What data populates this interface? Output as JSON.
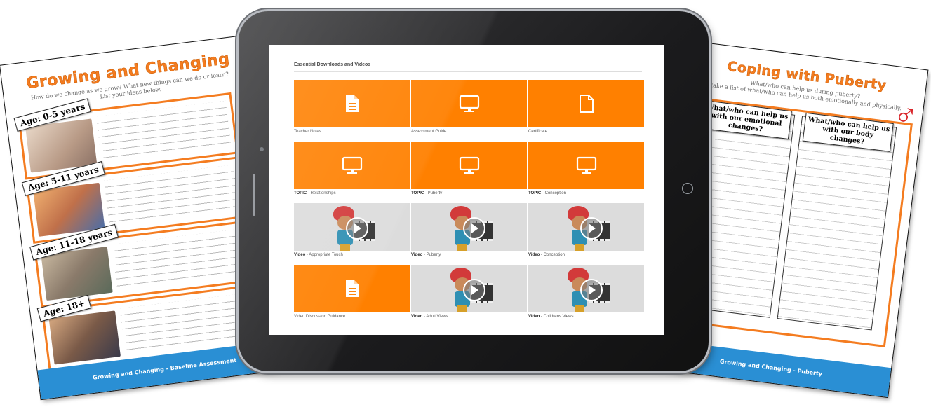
{
  "left_sheet": {
    "title": "Growing and Changing",
    "subtitle_line1": "How do we change as we grow? What new things can we do or learn?",
    "subtitle_line2": "List your ideas below.",
    "ages": [
      "Age: 0-5 years",
      "Age: 5-11 years",
      "Age: 11-18 years",
      "Age: 18+"
    ],
    "footer": "Growing and Changing - Baseline Assessment"
  },
  "right_sheet": {
    "title": "Coping with Puberty",
    "subtitle_line1": "What/who can help us during puberty?",
    "subtitle_line2": "Make a list of what/who can help us both emotionally and physically.",
    "col1_header": "What/who can help us with our emotional changes?",
    "col2_header": "What/who can help us with our body changes?",
    "footer": "Growing and Changing - Puberty",
    "female_symbol": "♀",
    "male_symbol": "♂"
  },
  "screen": {
    "title": "Essential Downloads and Videos",
    "tiles": [
      {
        "kind": "orange",
        "icon": "document-icon",
        "prefix": "",
        "label": "Teacher Notes"
      },
      {
        "kind": "orange",
        "icon": "monitor-icon",
        "prefix": "",
        "label": "Assessment Guide"
      },
      {
        "kind": "orange",
        "icon": "blank-page-icon",
        "prefix": "",
        "label": "Certificate"
      },
      {
        "kind": "orange",
        "icon": "monitor-icon",
        "prefix": "TOPIC",
        "label": " - Relationships"
      },
      {
        "kind": "orange",
        "icon": "monitor-icon",
        "prefix": "TOPIC",
        "label": " - Puberty"
      },
      {
        "kind": "orange",
        "icon": "monitor-icon",
        "prefix": "TOPIC",
        "label": " - Conception"
      },
      {
        "kind": "video",
        "icon": "play-icon",
        "prefix": "Video",
        "label": " - Appropriate Touch"
      },
      {
        "kind": "video",
        "icon": "play-icon",
        "prefix": "Video",
        "label": " - Puberty"
      },
      {
        "kind": "video",
        "icon": "play-icon",
        "prefix": "Video",
        "label": " - Conception"
      },
      {
        "kind": "orange",
        "icon": "document-icon",
        "prefix": "",
        "label": "Video Discussion Guidance"
      },
      {
        "kind": "video",
        "icon": "play-icon",
        "prefix": "Video",
        "label": " - Adult Views"
      },
      {
        "kind": "video",
        "icon": "play-icon",
        "prefix": "Video",
        "label": " - Childrens Views"
      }
    ]
  },
  "colors": {
    "orange": "#ff8000",
    "title_orange": "#f47c20",
    "footer_blue": "#2a8fd4",
    "symbol_red": "#d9262b",
    "tile_grey": "#dcdcdc"
  }
}
